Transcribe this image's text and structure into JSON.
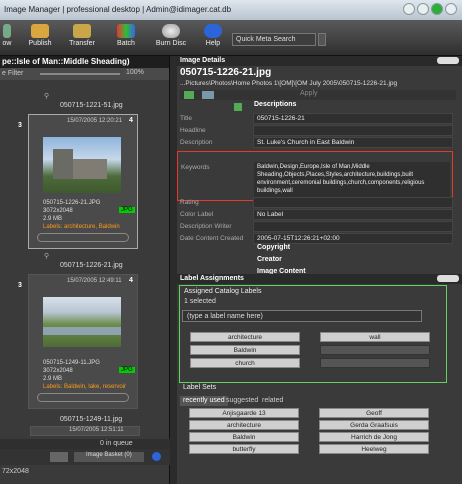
{
  "app": {
    "title": "Image Manager | professional desktop | Admin@idimager.cat.db"
  },
  "toolbar": {
    "show": "ow",
    "publish": "Publish",
    "transfer": "Transfer",
    "batch": "Batch",
    "burn": "Burn Disc",
    "help": "Help",
    "search_placeholder": "Quick Meta Search"
  },
  "left": {
    "header": "pe::Isle of Man::Middle Sheading)",
    "filter": "e Filter",
    "zoom": "100%",
    "top_filename": "050715-1221-51.jpg",
    "card1": {
      "date": "15/07/2005 12:20:21",
      "name": "050715-1226-21.JPG",
      "dims": "3072x2048",
      "size": "2.9 MB",
      "labels_prefix": "Labels:",
      "labels": "architecture, Baldwin",
      "format": "JPG",
      "num_left": "3",
      "num_right": "4"
    },
    "mid_filename": "050715-1226-21.jpg",
    "card2": {
      "date": "15/07/2005 12:49:11",
      "name": "050715-1249-11.JPG",
      "dims": "3072x2048",
      "size": "2.9 MB",
      "labels_prefix": "Labels:",
      "labels": "Baldwin, lake, reservoir",
      "format": "JPG",
      "num_left": "3",
      "num_right": "4"
    },
    "bottom_filename": "050715-1249-11.jpg",
    "bottom_date": "15/07/2005 12:51:11",
    "queue": "0 in queue",
    "basket": "Image Basket (0)",
    "status": "72x2048"
  },
  "details": {
    "panel_title": "Image Details",
    "filename": "050715-1226-21.jpg",
    "path": "...Pictures\\Photos\\Home Photos 1\\[OM]\\[OM July 2005\\050715-1226-21.jpg",
    "apply": "Apply",
    "descriptions_header": "Descriptions",
    "rows": [
      {
        "label": "Title",
        "value": "050715-1226-21"
      },
      {
        "label": "Headline",
        "value": ""
      },
      {
        "label": "Description",
        "value": "St. Luke's Church in East Baldwin"
      }
    ],
    "keywords_label": "Keywords",
    "keywords_value": "Baldwin,Design,Europe,Isle of Man,Middle Sheading,Objects,Places,Styles,architecture,buildings,built environment,ceremonial buildings,church,components,religious buildings,wall",
    "rating_label": "Rating",
    "rows2": [
      {
        "label": "Color Label",
        "value": "No Label"
      },
      {
        "label": "Description Writer",
        "value": ""
      },
      {
        "label": "Date Content Created",
        "value": "2005-07-15T12:26:21+02:00"
      }
    ],
    "copyright": "Copyright",
    "creator": "Creator",
    "image_content": "Image Content"
  },
  "labels": {
    "panel_title": "Label Assignments",
    "assigned_title": "Assigned Catalog Labels",
    "selected": "1 selected",
    "input_placeholder": "(type a label name here)",
    "assigned": [
      "architecture",
      "wall",
      "Baldwin",
      "church"
    ],
    "sets_title": "Label Sets",
    "tabs": [
      "recently used",
      "suggested",
      "related"
    ],
    "grid_left": [
      "Anjisgaarde 13",
      "architecture",
      "Baldwin",
      "butterfly"
    ],
    "grid_right": [
      "Geoff",
      "Gerda Graafsuis",
      "Harrich de Jong",
      "Heelweg"
    ]
  },
  "colors": {
    "highlight_red": "#e8372c",
    "highlight_green": "#5fd45f",
    "accent_orange": "#ff9a1a",
    "jpg_green": "#22cc22"
  }
}
